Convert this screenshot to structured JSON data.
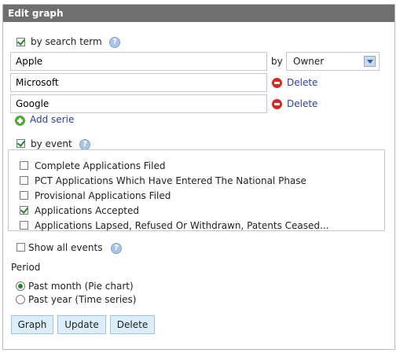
{
  "panel": {
    "title": "Edit graph"
  },
  "search": {
    "checkbox_label": "by search term",
    "checked": true,
    "help_glyph": "?",
    "terms": [
      {
        "value": "Apple"
      },
      {
        "value": "Microsoft"
      },
      {
        "value": "Google"
      }
    ],
    "by_label": "by",
    "by_select_value": "Owner",
    "delete_label": "Delete",
    "add_label": "Add serie"
  },
  "event": {
    "checkbox_label": "by event",
    "checked": true,
    "help_glyph": "?",
    "items": [
      {
        "label": "Complete Applications Filed",
        "checked": false
      },
      {
        "label": "PCT Applications Which Have Entered The National Phase",
        "checked": false
      },
      {
        "label": "Provisional Applications Filed",
        "checked": false
      },
      {
        "label": "Applications Accepted",
        "checked": true
      },
      {
        "label": "Applications Lapsed, Refused Or Withdrawn, Patents Ceased...",
        "checked": false
      }
    ],
    "show_all_label": "Show all events",
    "show_all_checked": false
  },
  "period": {
    "label": "Period",
    "options": [
      {
        "label": "Past month (Pie chart)",
        "selected": true
      },
      {
        "label": "Past year (Time series)",
        "selected": false
      }
    ]
  },
  "buttons": {
    "graph": "Graph",
    "update": "Update",
    "delete": "Delete"
  },
  "icons": {
    "help": "help-icon",
    "delete": "delete-icon",
    "add": "add-icon",
    "dropdown": "chevron-down-icon"
  },
  "colors": {
    "title_bar": "#6f6f6f",
    "link": "#2a3eae",
    "button_bg": "#dceefb",
    "check": "#1d8a1d",
    "delete_icon": "#d9291c",
    "add_icon": "#4cae2d"
  }
}
